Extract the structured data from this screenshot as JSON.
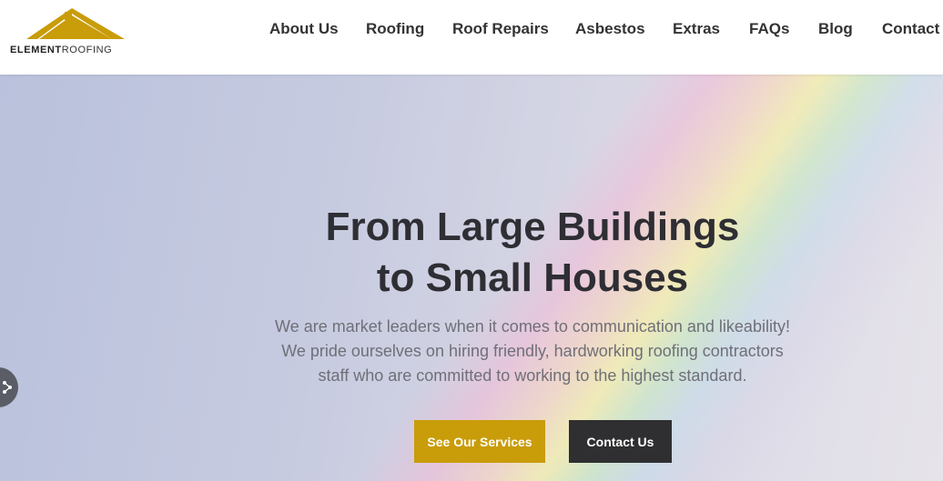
{
  "header": {
    "logo": {
      "name_part1": "ELEMENT",
      "name_part2": "ROOFING",
      "roof_color": "#c99c0a"
    },
    "nav": [
      {
        "label": "About Us"
      },
      {
        "label": "Roofing"
      },
      {
        "label": "Roof Repairs"
      },
      {
        "label": "Asbestos"
      },
      {
        "label": "Extras"
      },
      {
        "label": "FAQs"
      },
      {
        "label": "Blog"
      },
      {
        "label": "Contact"
      }
    ]
  },
  "hero": {
    "title_line1": "From Large Buildings",
    "title_line2": "to Small Houses",
    "text_line1": "We are market leaders when it comes to communication and likeability!",
    "text_line2": "We pride ourselves on hiring friendly, hardworking roofing contractors",
    "text_line3": "staff who are committed to working to the highest standard.",
    "primary_button": "See Our Services",
    "secondary_button": "Contact Us",
    "colors": {
      "primary_button": "#c99c0a",
      "secondary_button": "#2f2f31",
      "title": "#2e2e34"
    }
  },
  "side_tab": {
    "icon": "share-icon"
  }
}
